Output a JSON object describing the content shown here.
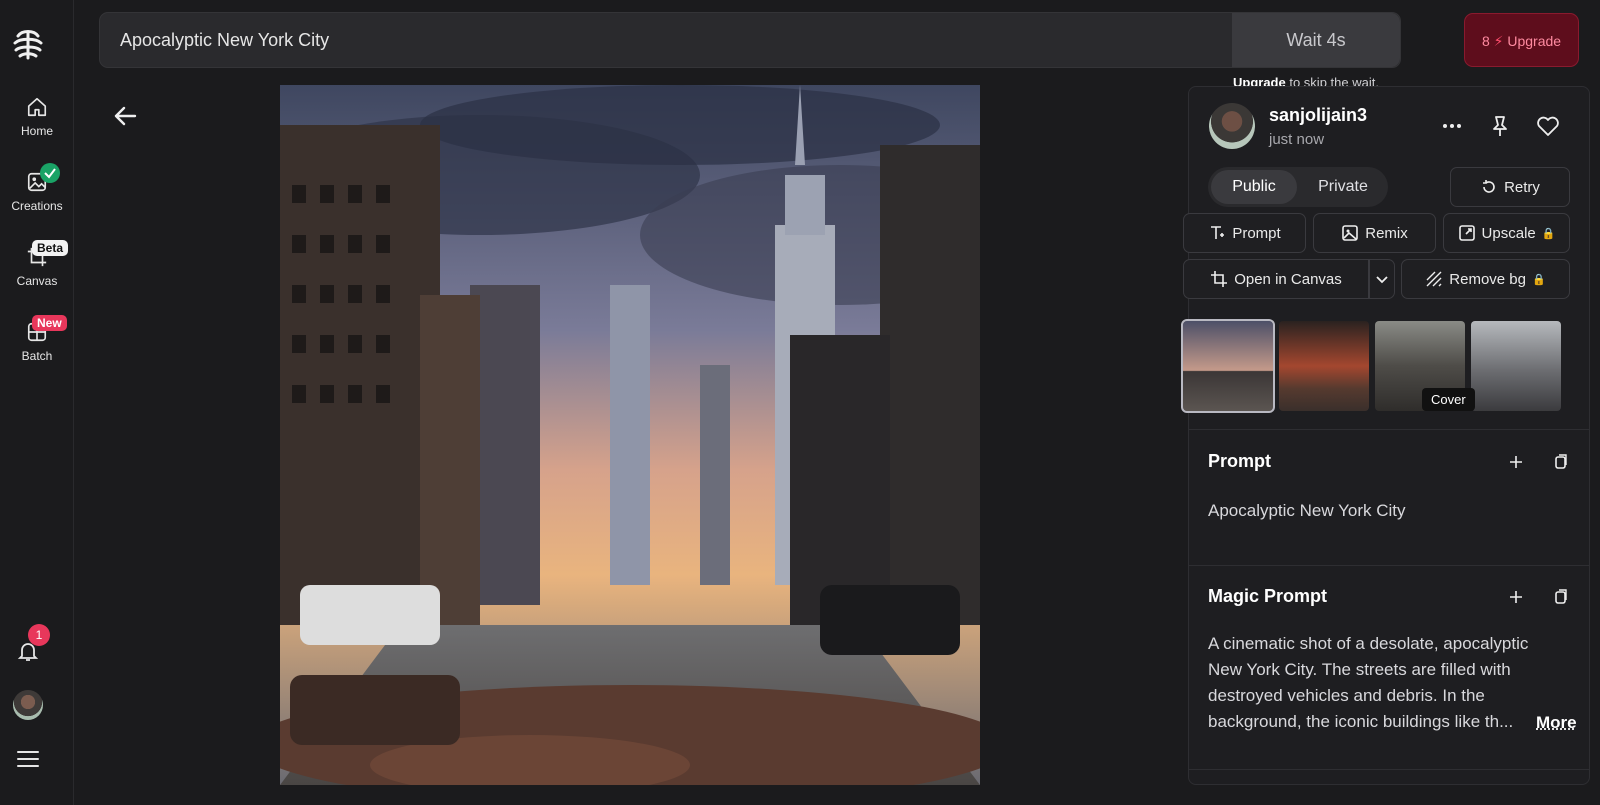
{
  "sidebar": {
    "items": [
      {
        "label": "Home",
        "icon": "home-icon"
      },
      {
        "label": "Creations",
        "icon": "image-icon",
        "badge": "check"
      },
      {
        "label": "Canvas",
        "icon": "crop-icon",
        "badge": "Beta"
      },
      {
        "label": "Batch",
        "icon": "grid-icon",
        "badge": "New"
      }
    ],
    "notification_count": "1"
  },
  "header": {
    "prompt": "Apocalyptic New York City",
    "wait": "Wait 4s",
    "credits": "8",
    "upgrade_label": "Upgrade",
    "skip_link": "Upgrade",
    "skip_text": " to skip the wait."
  },
  "panel": {
    "username": "sanjolijain3",
    "time": "just now",
    "visibility": {
      "public": "Public",
      "private": "Private"
    },
    "buttons": {
      "retry": "Retry",
      "prompt": "Prompt",
      "remix": "Remix",
      "upscale": "Upscale",
      "open_canvas": "Open in Canvas",
      "remove_bg": "Remove bg"
    },
    "cover_tooltip": "Cover",
    "prompt_section": {
      "title": "Prompt",
      "text": "Apocalyptic New York City"
    },
    "magic_section": {
      "title": "Magic Prompt",
      "text": "A cinematic shot of a desolate, apocalyptic New York City. The streets are filled with destroyed vehicles and debris. In the background, the iconic buildings like th...",
      "more": "More"
    }
  },
  "colors": {
    "accent_upgrade": "#5e0d1c",
    "badge_new": "#e8375b",
    "badge_check": "#1aa366"
  }
}
